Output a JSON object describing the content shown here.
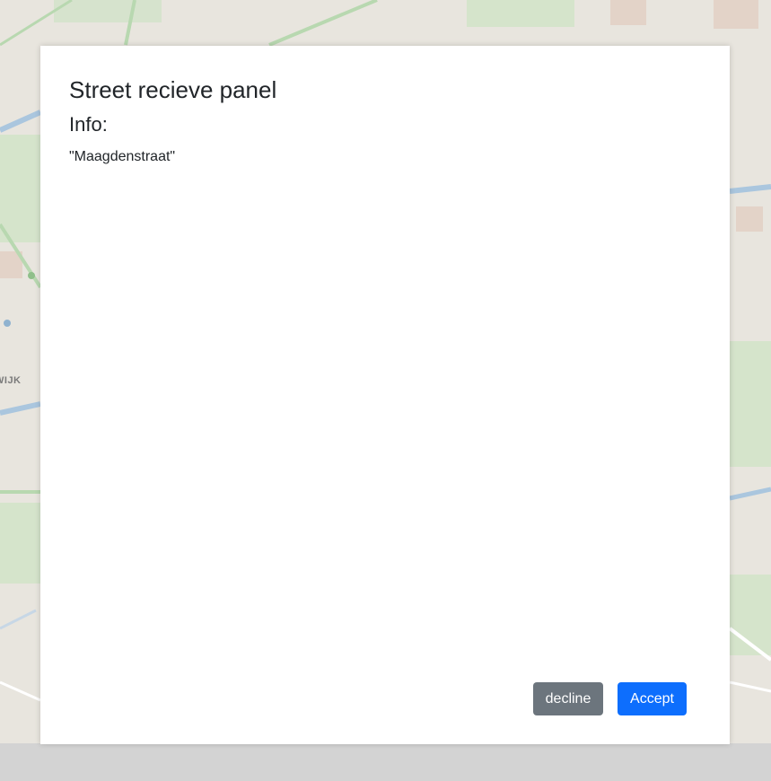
{
  "panel": {
    "title": "Street recieve panel",
    "info_heading": "Info:",
    "info_value": "\"Maagdenstraat\""
  },
  "buttons": {
    "decline_label": "decline",
    "accept_label": "Accept"
  },
  "map": {
    "partial_label": "WIJK"
  },
  "colors": {
    "decline_bg": "#6c757d",
    "accept_bg": "#0d6efd",
    "panel_bg": "#ffffff",
    "overlay_bg": "#d3d3d3"
  }
}
